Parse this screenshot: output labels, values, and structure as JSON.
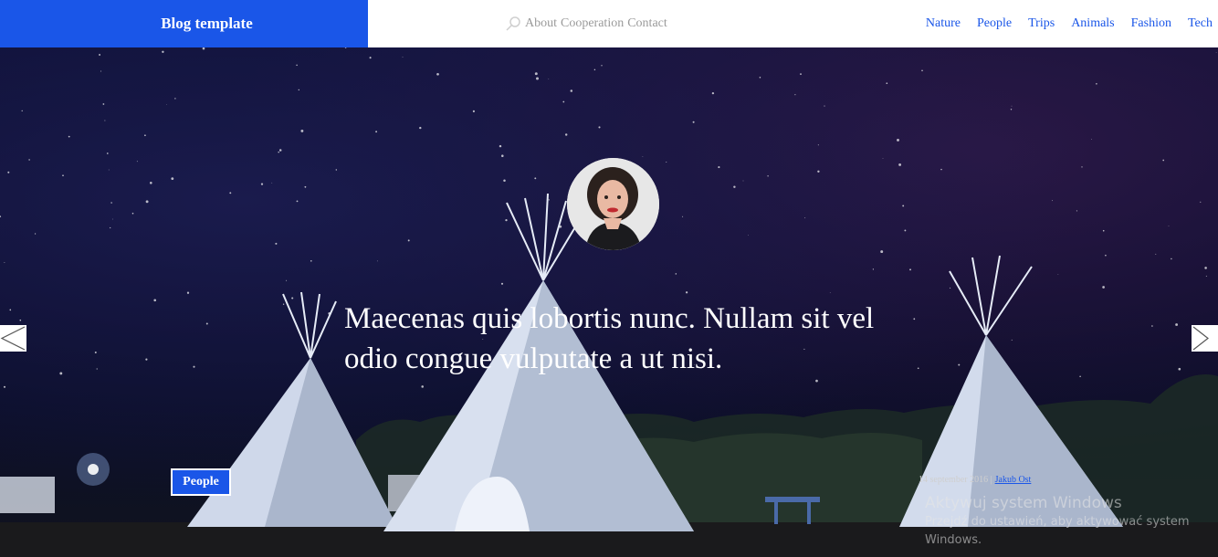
{
  "header": {
    "brand": "Blog template",
    "top_links": [
      "About",
      "Cooperation",
      "Contact"
    ],
    "categories": [
      "Nature",
      "People",
      "Trips",
      "Animals",
      "Fashion",
      "Tech"
    ]
  },
  "hero": {
    "headline": "Maecenas quis lobortis nunc. Nullam sit vel odio congue vulputate a ut nisi.",
    "tag": "People",
    "date": "14 september 2016 |",
    "author": "Jakub Ost"
  },
  "os_watermark": {
    "title": "Aktywuj system Windows",
    "subtitle": "Przejdź do ustawień, aby aktywować system Windows."
  },
  "colors": {
    "accent": "#1a56e8",
    "sky": "#0d0f34",
    "white": "#ffffff"
  },
  "icons": {
    "search": "search-icon",
    "prev": "chevron-left-icon",
    "next": "chevron-right-icon"
  }
}
